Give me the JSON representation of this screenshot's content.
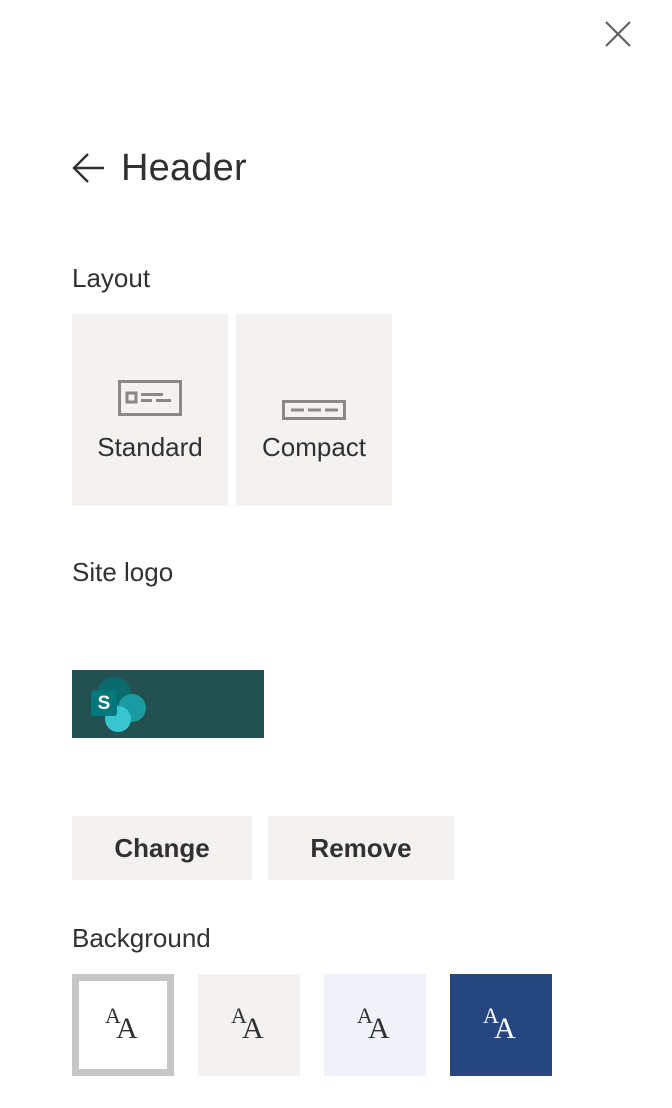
{
  "panel": {
    "title": "Header",
    "back_icon": "arrow-left-icon",
    "close_icon": "close-icon"
  },
  "layout": {
    "label": "Layout",
    "options": [
      {
        "label": "Standard",
        "icon": "standard-layout-icon"
      },
      {
        "label": "Compact",
        "icon": "compact-layout-icon"
      }
    ]
  },
  "site_logo": {
    "label": "Site logo",
    "logo_icon": "sharepoint-logo-icon",
    "logo_letter": "S",
    "logo_background": "#235152",
    "change_label": "Change",
    "remove_label": "Remove"
  },
  "background": {
    "label": "Background",
    "glyph_small": "A",
    "glyph_big": "A",
    "swatches": [
      {
        "name": "white",
        "color": "#ffffff",
        "text_color": "#323130",
        "selected": true
      },
      {
        "name": "light-gray",
        "color": "#f3f2f1",
        "text_color": "#323130",
        "selected": false
      },
      {
        "name": "light-blue",
        "color": "#eff3f9",
        "text_color": "#323130",
        "selected": false
      },
      {
        "name": "dark-blue",
        "color": "#26467f",
        "text_color": "#ffffff",
        "selected": false
      }
    ]
  }
}
